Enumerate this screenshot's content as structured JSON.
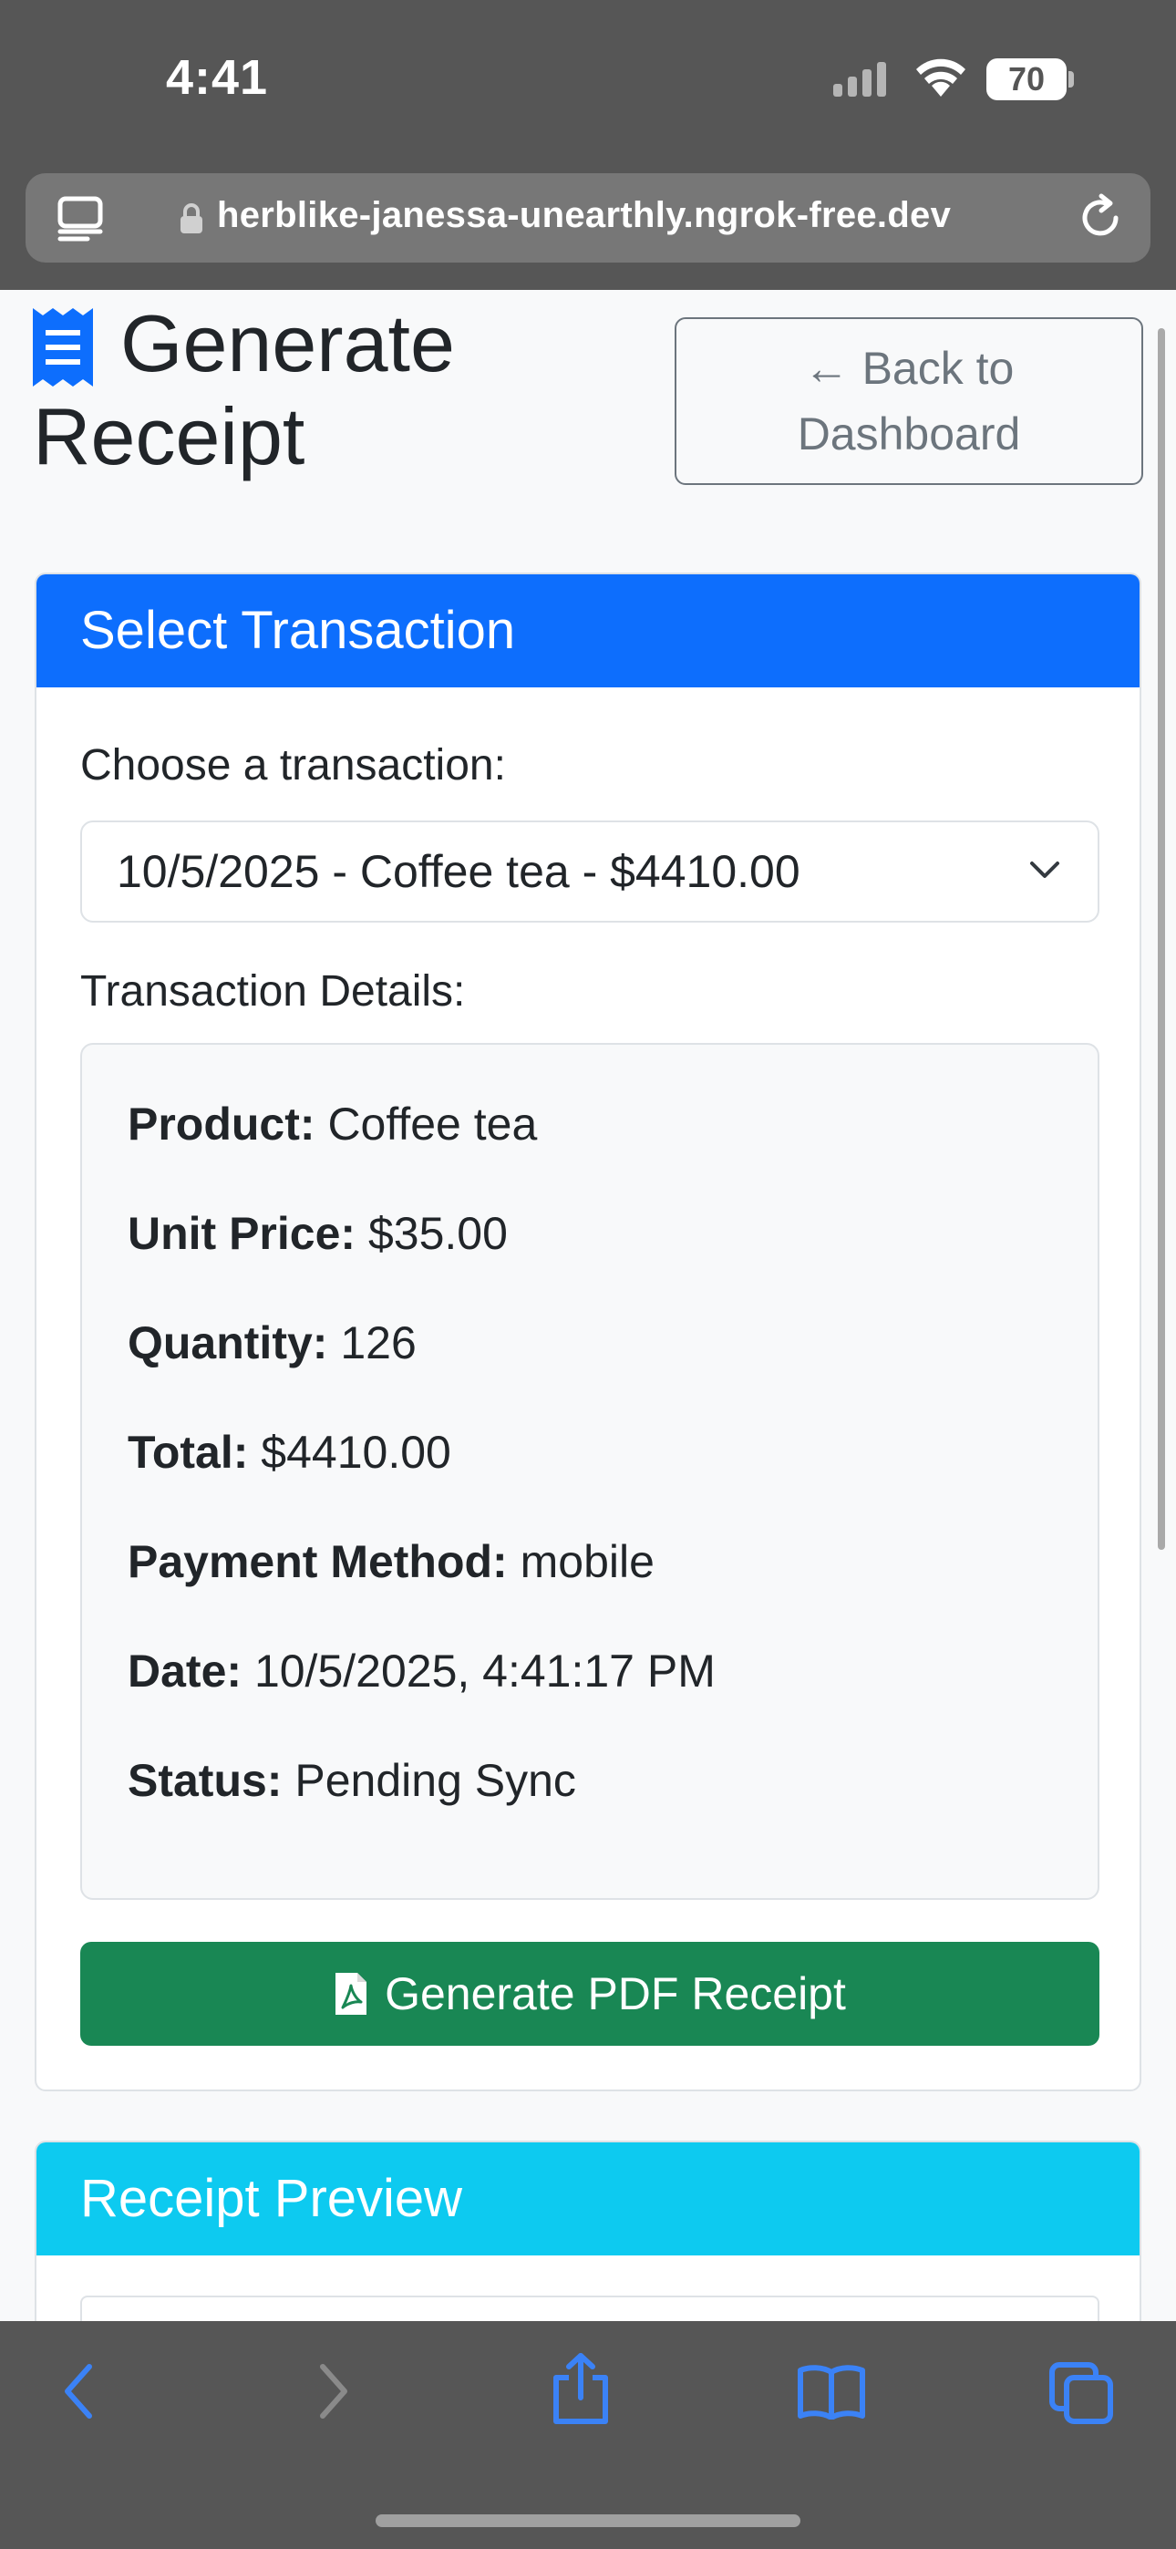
{
  "status_bar": {
    "time": "4:41",
    "battery": "70",
    "icons": [
      "cellular-signal-icon",
      "wifi-icon",
      "battery-icon"
    ]
  },
  "browser": {
    "url": "herblike-janessa-unearthly.ngrok-free.dev",
    "icons": [
      "page-menu-icon",
      "lock-icon",
      "reload-icon"
    ]
  },
  "page": {
    "title_line1": "Generate",
    "title_line2": "Receipt",
    "title_icon": "receipt-icon",
    "back_button_arrow": "←",
    "back_button_line1": "Back to",
    "back_button_line2": "Dashboard"
  },
  "select_card": {
    "header": "Select Transaction",
    "choose_label": "Choose a transaction:",
    "selected_transaction": "10/5/2025 - Coffee tea - $4410.00",
    "details_label": "Transaction Details:",
    "details": {
      "product_label": "Product:",
      "product": "Coffee tea",
      "unit_price_label": "Unit Price:",
      "unit_price": "$35.00",
      "quantity_label": "Quantity:",
      "quantity": "126",
      "total_label": "Total:",
      "total": "$4410.00",
      "payment_method_label": "Payment Method:",
      "payment_method": "mobile",
      "date_label": "Date:",
      "date": "10/5/2025, 4:41:17 PM",
      "status_label": "Status:",
      "status": "Pending Sync"
    },
    "generate_button": "Generate PDF Receipt"
  },
  "preview_card": {
    "header": "Receipt Preview"
  },
  "toolbar": {
    "icons": [
      "back-icon",
      "forward-icon",
      "share-icon",
      "bookmarks-icon",
      "tabs-icon"
    ]
  },
  "colors": {
    "primary": "#0d6efd",
    "info": "#0dcaf0",
    "success": "#198754",
    "secondary": "#6c757d",
    "ios_blue": "#3b82f6"
  }
}
